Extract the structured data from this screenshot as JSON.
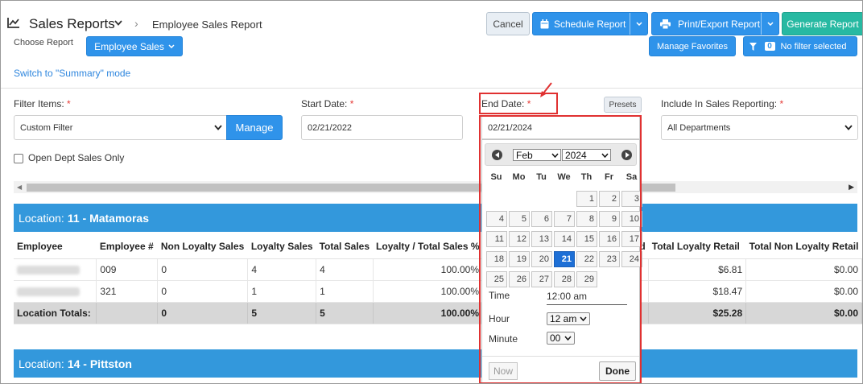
{
  "header": {
    "app_title": "Sales Reports",
    "breadcrumb": "Employee Sales Report",
    "cancel": "Cancel",
    "schedule": "Schedule Report",
    "print": "Print/Export Report",
    "generate": "Generate Report"
  },
  "subheader": {
    "choose_label": "Choose Report",
    "choose_value": "Employee Sales",
    "favorites": "Manage Favorites",
    "filter_count": "0",
    "no_filter": "No filter selected",
    "switch_link": "Switch to \"Summary\" mode"
  },
  "filters": {
    "items_label": "Filter Items:",
    "items_value": "Custom Filter",
    "manage": "Manage",
    "start_label": "Start Date:",
    "start_value": "02/21/2022",
    "end_label": "End Date:",
    "end_value": "02/21/2024",
    "presets": "Presets",
    "include_label": "Include In Sales Reporting:",
    "include_value": "All Departments",
    "required_mark": "*",
    "open_dept": "Open Dept Sales Only"
  },
  "locations": [
    {
      "prefix": "Location:",
      "name": "11 - Matamoras"
    },
    {
      "prefix": "Location:",
      "name": "14 - Pittston"
    }
  ],
  "table": {
    "columns": [
      "Employee",
      "Employee #",
      "Non Loyalty Sales",
      "Loyalty Sales",
      "Total Sales",
      "Loyalty / Total Sales %",
      "",
      "d",
      "Total Loyalty Retail",
      "Total Non Loyalty Retail"
    ],
    "rows": [
      {
        "emp_no": "009",
        "non_loyalty": "0",
        "loyalty": "4",
        "total": "4",
        "pct": "100.00%",
        "loyalty_retail": "$6.81",
        "non_loyalty_retail": "$0.00"
      },
      {
        "emp_no": "321",
        "non_loyalty": "0",
        "loyalty": "1",
        "total": "1",
        "pct": "100.00%",
        "loyalty_retail": "$18.47",
        "non_loyalty_retail": "$0.00"
      }
    ],
    "totals": {
      "label": "Location Totals:",
      "non_loyalty": "0",
      "loyalty": "5",
      "total": "5",
      "pct": "100.00%",
      "loyalty_retail": "$25.28",
      "non_loyalty_retail": "$0.00"
    }
  },
  "datepicker": {
    "month": "Feb",
    "year": "2024",
    "weekdays": [
      "Su",
      "Mo",
      "Tu",
      "We",
      "Th",
      "Fr",
      "Sa"
    ],
    "weeks": [
      [
        "",
        "",
        "",
        "",
        "1",
        "2",
        "3"
      ],
      [
        "4",
        "5",
        "6",
        "7",
        "8",
        "9",
        "10"
      ],
      [
        "11",
        "12",
        "13",
        "14",
        "15",
        "16",
        "17"
      ],
      [
        "18",
        "19",
        "20",
        "21",
        "22",
        "23",
        "24"
      ],
      [
        "25",
        "26",
        "27",
        "28",
        "29",
        "",
        ""
      ]
    ],
    "selected_day": "21",
    "time_label": "Time",
    "time_value": "12:00 am",
    "hour_label": "Hour",
    "hour_value": "12 am",
    "minute_label": "Minute",
    "minute_value": "00",
    "now": "Now",
    "done": "Done"
  },
  "colors": {
    "primary": "#2f93ea",
    "teal": "#27b9a2",
    "location_bar": "#3398dc",
    "annotation": "#e03131",
    "selected_day": "#1d6fd6"
  }
}
